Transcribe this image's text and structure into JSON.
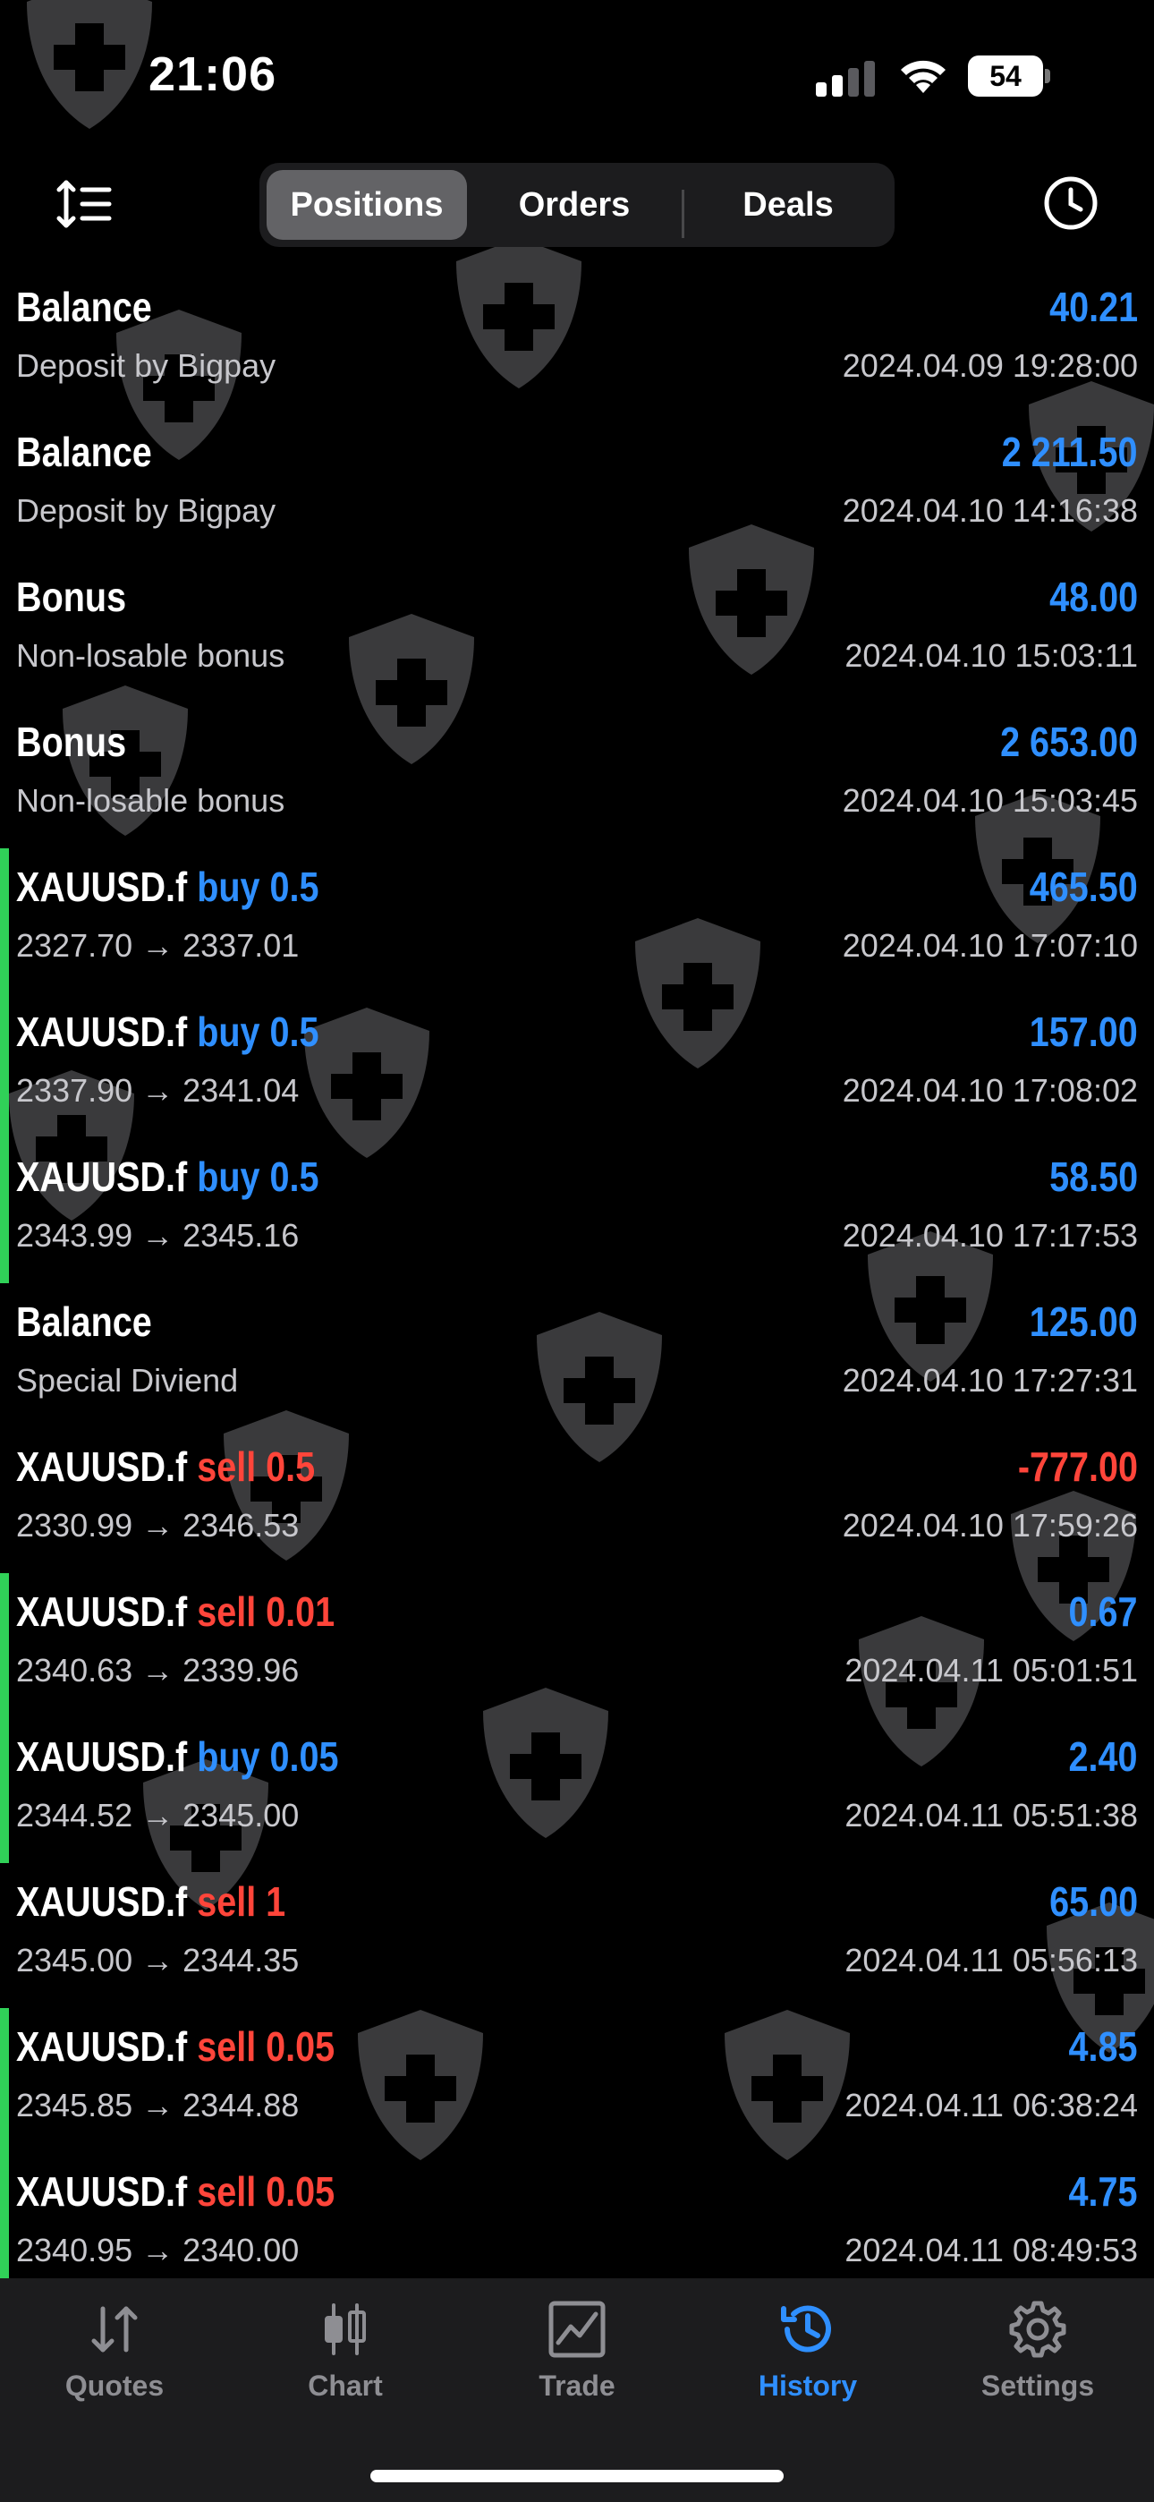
{
  "status_bar": {
    "time": "21:06",
    "battery": "54"
  },
  "segments": [
    {
      "label": "Positions",
      "active": true
    },
    {
      "label": "Orders",
      "active": false
    },
    {
      "label": "Deals",
      "active": false
    }
  ],
  "rows": [
    {
      "name": "Balance",
      "kind": "",
      "sub": "Deposit by Bigpay",
      "amount": "40.21",
      "date": "2024.04.09 19:28:00",
      "bar": false,
      "neg": false
    },
    {
      "name": "Balance",
      "kind": "",
      "sub": "Deposit by Bigpay",
      "amount": "2 211.50",
      "date": "2024.04.10 14:16:38",
      "bar": false,
      "neg": false
    },
    {
      "name": "Bonus",
      "kind": "",
      "sub": "Non-losable bonus",
      "amount": "48.00",
      "date": "2024.04.10 15:03:11",
      "bar": false,
      "neg": false
    },
    {
      "name": "Bonus",
      "kind": "",
      "sub": "Non-losable bonus",
      "amount": "2 653.00",
      "date": "2024.04.10 15:03:45",
      "bar": false,
      "neg": false
    },
    {
      "name": "XAUUSD.f",
      "kind": "buy 0.5",
      "sub": "2327.70 → 2337.01",
      "amount": "465.50",
      "date": "2024.04.10 17:07:10",
      "bar": true,
      "neg": false
    },
    {
      "name": "XAUUSD.f",
      "kind": "buy 0.5",
      "sub": "2337.90 → 2341.04",
      "amount": "157.00",
      "date": "2024.04.10 17:08:02",
      "bar": true,
      "neg": false
    },
    {
      "name": "XAUUSD.f",
      "kind": "buy 0.5",
      "sub": "2343.99 → 2345.16",
      "amount": "58.50",
      "date": "2024.04.10 17:17:53",
      "bar": true,
      "neg": false
    },
    {
      "name": "Balance",
      "kind": "",
      "sub": "Special Diviend",
      "amount": "125.00",
      "date": "2024.04.10 17:27:31",
      "bar": false,
      "neg": false
    },
    {
      "name": "XAUUSD.f",
      "kind": "sell 0.5",
      "sub": "2330.99 → 2346.53",
      "amount": "-777.00",
      "date": "2024.04.10 17:59:26",
      "bar": false,
      "neg": true
    },
    {
      "name": "XAUUSD.f",
      "kind": "sell 0.01",
      "sub": "2340.63 → 2339.96",
      "amount": "0.67",
      "date": "2024.04.11 05:01:51",
      "bar": true,
      "neg": false
    },
    {
      "name": "XAUUSD.f",
      "kind": "buy 0.05",
      "sub": "2344.52 → 2345.00",
      "amount": "2.40",
      "date": "2024.04.11 05:51:38",
      "bar": true,
      "neg": false
    },
    {
      "name": "XAUUSD.f",
      "kind": "sell 1",
      "sub": "2345.00 → 2344.35",
      "amount": "65.00",
      "date": "2024.04.11 05:56:13",
      "bar": false,
      "neg": false
    },
    {
      "name": "XAUUSD.f",
      "kind": "sell 0.05",
      "sub": "2345.85 → 2344.88",
      "amount": "4.85",
      "date": "2024.04.11 06:38:24",
      "bar": true,
      "neg": false
    },
    {
      "name": "XAUUSD.f",
      "kind": "sell 0.05",
      "sub": "2340.95 → 2340.00",
      "amount": "4.75",
      "date": "2024.04.11 08:49:53",
      "bar": true,
      "neg": false
    }
  ],
  "tabs": [
    {
      "label": "Quotes",
      "icon": "quotes-arrows-icon",
      "active": false
    },
    {
      "label": "Chart",
      "icon": "candlestick-icon",
      "active": false
    },
    {
      "label": "Trade",
      "icon": "trade-chart-icon",
      "active": false
    },
    {
      "label": "History",
      "icon": "history-clock-icon",
      "active": true
    },
    {
      "label": "Settings",
      "icon": "gear-icon",
      "active": false
    }
  ],
  "colors": {
    "buy": "#2f8fff",
    "sell": "#ff453a",
    "profit": "#2f8fff",
    "loss": "#ff453a",
    "bar": "#30d158",
    "tab_active": "#2f8fff"
  }
}
